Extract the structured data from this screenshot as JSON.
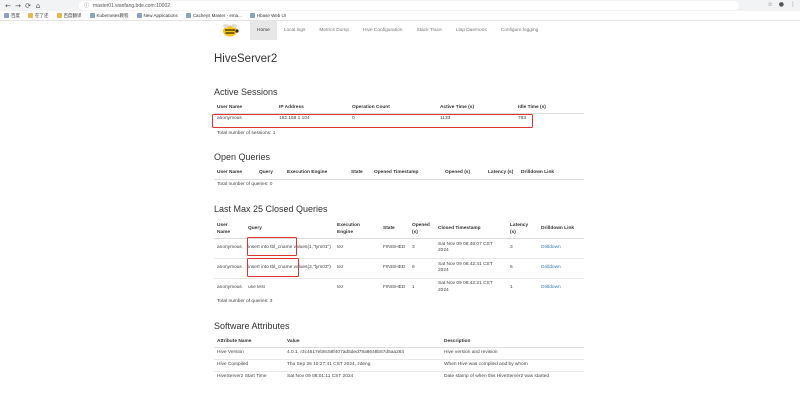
{
  "browser": {
    "url": "master01.wanfang.bde.com:10002",
    "bookmarks": [
      "百度",
      "在了还",
      "百度翻译",
      "Kubernetes教程",
      "New Applications",
      "Cacheys Master - ema...",
      "Hbase Web UI"
    ]
  },
  "navbar": {
    "links": [
      "Home",
      "Local logs",
      "Metrics Dump",
      "Hive Configuration",
      "Stack Trace",
      "Llap Daemons",
      "Configure logging"
    ]
  },
  "page_title": "HiveServer2",
  "active_sessions": {
    "heading": "Active Sessions",
    "columns": [
      "User Name",
      "IP Address",
      "Operation Count",
      "Active Time (s)",
      "Idle Time (s)"
    ],
    "rows": [
      [
        "anonymous",
        "192.168.1.104",
        "0",
        "1133",
        "783"
      ]
    ],
    "total": "Total number of sessions: 1"
  },
  "open_queries": {
    "heading": "Open Queries",
    "columns": [
      "User Name",
      "Query",
      "Execution Engine",
      "State",
      "Opened Timestamp",
      "Opened (s)",
      "Latency (s)",
      "Drilldown Link"
    ],
    "total": "Total number of queries: 0"
  },
  "closed_queries": {
    "heading": "Last Max 25 Closed Queries",
    "columns": [
      "User Name",
      "Query",
      "Execution Engine",
      "State",
      "Opened (s)",
      "Closed Timestamp",
      "Latency (s)",
      "Drilldown Link"
    ],
    "rows": [
      {
        "user": "anonymous",
        "query": "insert into tbl_cname values(1,\"lym01\")",
        "engine": "tez",
        "state": "FINISHED",
        "opened": "3",
        "closed": "Sat Nov 09 08:48:07 CST 2024",
        "latency": "3",
        "link": "Drilldown"
      },
      {
        "user": "anonymous",
        "query": "insert into tbl_cname values(3,\"lym03\")",
        "engine": "tez",
        "state": "FINISHED",
        "opened": "6",
        "closed": "Sat Nov 09 08:42:41 CST 2024",
        "latency": "6",
        "link": "Drilldown"
      },
      {
        "user": "anonymous",
        "query": "use test",
        "engine": "tez",
        "state": "FINISHED",
        "opened": "1",
        "closed": "Sat Nov 09 08:42:21 CST 2024",
        "latency": "1",
        "link": "Drilldown"
      }
    ],
    "total": "Total number of queries: 3"
  },
  "software_attributes": {
    "heading": "Software Attributes",
    "columns": [
      "Attribute Name",
      "Value",
      "Description"
    ],
    "rows": [
      [
        "Hive Version",
        "4.0.1, r3c4617eb8c58f407ad5ded78a8648b57d5aa264",
        "Hive version and revision"
      ],
      [
        "Hive Compiled",
        "Thu Sep 26 10:27:41 CST 2024, zdeng",
        "When Hive was compiled and by whom"
      ],
      [
        "HiveServer2 Start Time",
        "Sat Nov 09 08:01:11 CST 2024",
        "Date stamp of when this HiveServer2 was started"
      ]
    ]
  },
  "colors": {
    "highlight": "#e0322e",
    "link": "#337ab7",
    "nav_active_bg": "#e7e7e7"
  }
}
